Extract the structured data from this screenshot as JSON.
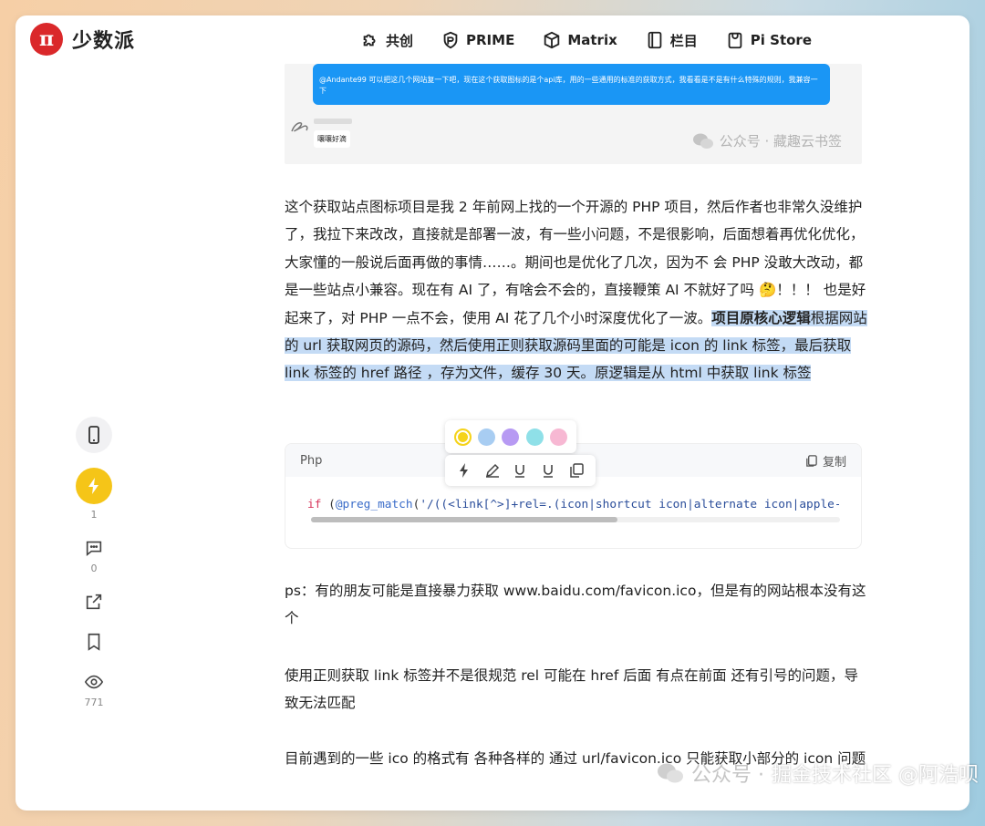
{
  "header": {
    "logo_text": "少数派",
    "logo_glyph": "π",
    "nav": [
      {
        "label": "共创",
        "icon": "puzzle-icon"
      },
      {
        "label": "PRIME",
        "icon": "prime-icon"
      },
      {
        "label": "Matrix",
        "icon": "matrix-icon"
      },
      {
        "label": "栏目",
        "icon": "column-icon"
      },
      {
        "label": "Pi Store",
        "icon": "store-icon"
      }
    ]
  },
  "rail": {
    "likes": "1",
    "comments": "0",
    "views": "771"
  },
  "image": {
    "bubble_text": "@Andante99 可以把这几个网站复一下吧，现在这个获取图标的是个api库，用的一些通用的标准的获取方式，我看看是不是有什么特殊的规则，我兼容一下",
    "reply_text": "嚷嚷好滴",
    "watermark": "公众号 · 藏趣云书签"
  },
  "article": {
    "p1_plain": "这个获取站点图标项目是我 2 年前网上找的一个开源的 PHP 项目，然后作者也非常久没维护了，我拉下来改改，直接就是部署一波，有一些小问题，不是很影响，后面想着再优化优化，大家懂的一般说后面再做的事情……。期间也是优化了几次，因为不 会 PHP 没敢大改动，都是一些站点小兼容。现在有 AI 了，有啥会不会的，直接鞭策 AI 不就好了吗 🤔！！！ 也是好起来了，对 PHP 一点不会，使用 AI 花了几个小时深度优化了一波。",
    "p1_bold": "项目原核心逻辑",
    "p1_highlight": "根据网站的 url 获取网页的源码，然后使用正则获取源码里面的可能是 icon 的 link 标签，最后获取 link 标签的 href 路径 ，存为文件，缓存 30 天。原逻辑是从 html 中获取 link 标签",
    "p2": "ps：有的朋友可能是直接暴力获取 www.baidu.com/favicon.ico，但是有的网站根本没有这个",
    "p3": "使用正则获取 link 标签并不是很规范 rel 可能在 href 后面 有点在前面 还有引号的问题，导致无法匹配",
    "p4": "目前遇到的一些 ico 的格式有 各种各样的 通过 url/favicon.ico 只能获取小部分的 icon 问题"
  },
  "highlight_colors": [
    "#f5d31a",
    "#a8cdf2",
    "#b79af3",
    "#8fe0e8",
    "#f7b8d3"
  ],
  "code": {
    "lang": "Php",
    "copy_label": "复制",
    "line_kw": "if",
    "line_fn": "@preg_match",
    "line_rest": " (",
    "line_str": "'/((<link[^>]+rel=.(icon|shortcut icon|alternate icon|apple-"
  },
  "footer_watermark": {
    "faint": "公众号 · ",
    "main": "掘金技术社区 @阿浩呗"
  }
}
